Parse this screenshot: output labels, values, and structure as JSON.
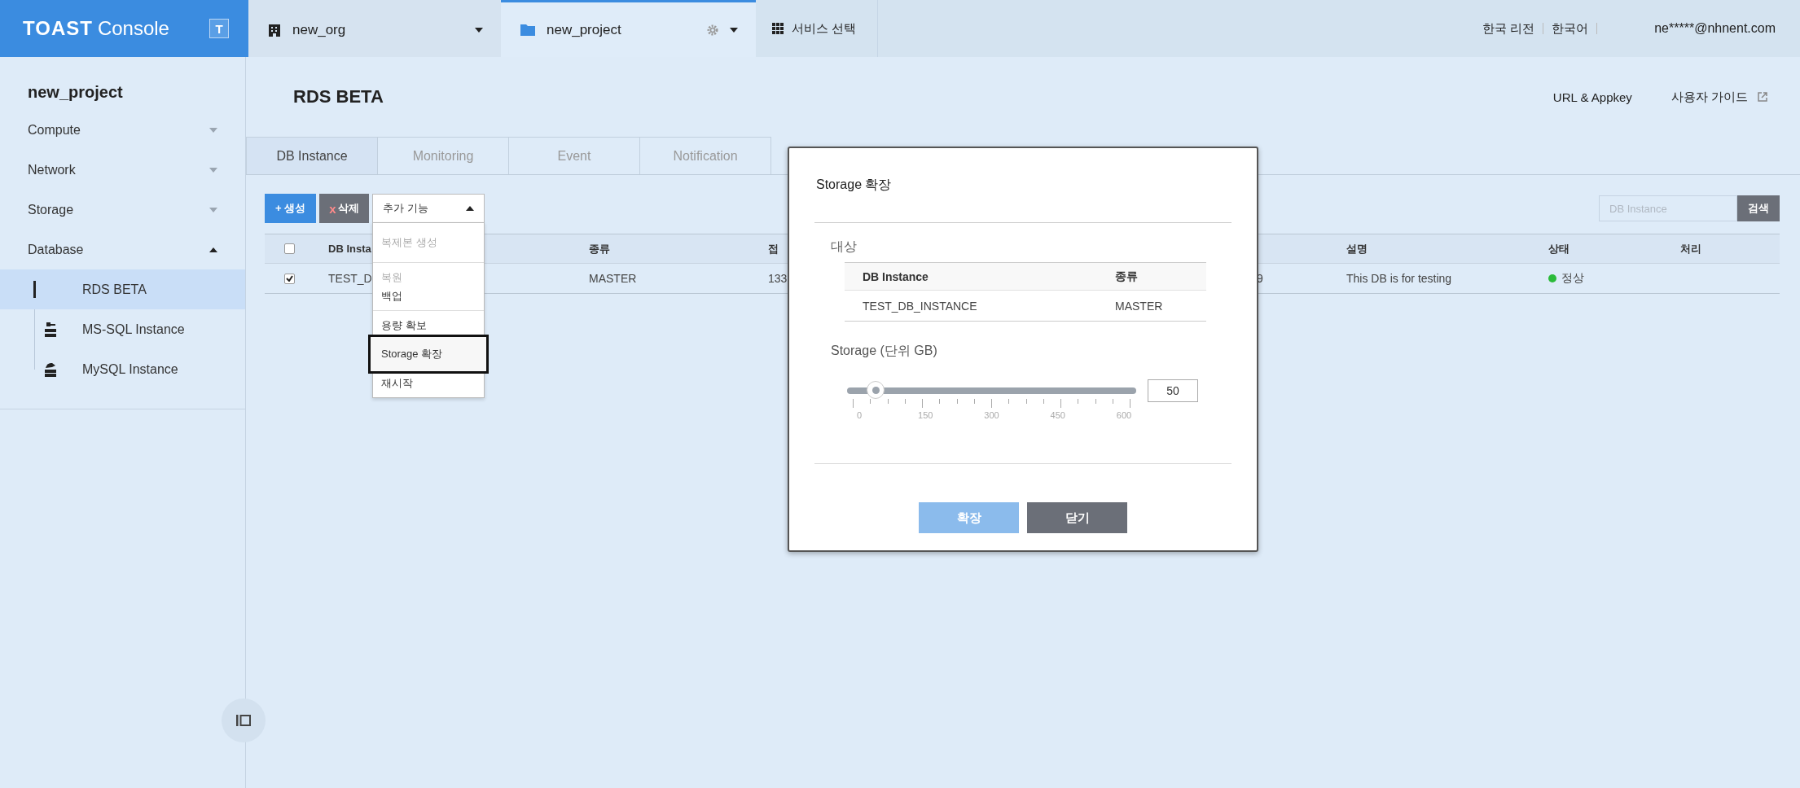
{
  "topbar": {
    "logo": {
      "brand": "TOAST",
      "product": "Console",
      "badge": "T"
    },
    "context_tabs": [
      {
        "kind": "org",
        "label": "new_org",
        "selected": false
      },
      {
        "kind": "project",
        "label": "new_project",
        "selected": true
      }
    ],
    "service_menu": "서비스 선택",
    "links": [
      "한국 리전",
      "한국어"
    ],
    "user": "ne*****@nhnent.com"
  },
  "sidebar": {
    "project": "new_project",
    "items": [
      {
        "label": "Compute",
        "expanded": false
      },
      {
        "label": "Network",
        "expanded": false
      },
      {
        "label": "Storage",
        "expanded": false
      },
      {
        "label": "Database",
        "expanded": true,
        "children": [
          {
            "label": "RDS BETA",
            "kind": "plain",
            "selected": true
          },
          {
            "label": "MS-SQL Instance",
            "kind": "mssql",
            "selected": false
          },
          {
            "label": "MySQL Instance",
            "kind": "mysql",
            "selected": false
          }
        ]
      }
    ]
  },
  "page": {
    "title": "RDS BETA",
    "links": [
      {
        "label": "URL & Appkey",
        "external": false
      },
      {
        "label": "사용자 가이드",
        "external": true
      }
    ]
  },
  "tabs": [
    {
      "label": "DB Instance",
      "selected": true
    },
    {
      "label": "Monitoring",
      "selected": false
    },
    {
      "label": "Event",
      "selected": false
    },
    {
      "label": "Notification",
      "selected": false
    }
  ],
  "toolbar": {
    "create": {
      "icon": "+",
      "label": "생성"
    },
    "delete": {
      "icon": "x",
      "label": "삭제"
    },
    "more": {
      "label": "추가 기능",
      "expanded": true
    }
  },
  "menu": {
    "groups": [
      {
        "items": [
          {
            "label": "복제본 생성",
            "disabled": true,
            "selected": false
          }
        ]
      },
      {
        "items": [
          {
            "label": "복원",
            "disabled": true,
            "selected": false
          },
          {
            "label": "백업",
            "disabled": false,
            "selected": false
          }
        ]
      },
      {
        "items": [
          {
            "label": "용량 확보",
            "disabled": false,
            "selected": false
          },
          {
            "label": "Storage 확장",
            "disabled": false,
            "selected": true
          },
          {
            "label": "재시작",
            "disabled": false,
            "selected": false
          }
        ]
      }
    ]
  },
  "search": {
    "placeholder": "DB Instance",
    "button": "검색"
  },
  "table": {
    "header_checked": false,
    "columns": [
      {
        "kind": "text",
        "label": "DB Insta"
      },
      {
        "kind": "text",
        "label": "종류"
      },
      {
        "kind": "text",
        "label": "접"
      },
      {
        "kind": "text"
      },
      {
        "kind": "text",
        "label": "설명"
      },
      {
        "kind": "status",
        "label": "상태"
      },
      {
        "kind": "text",
        "label": "처리"
      }
    ],
    "rows": [
      {
        "checked": true,
        "cells": [
          "TEST_D",
          "MASTER",
          "133",
          "9",
          "This DB is for testing",
          {
            "label": "정상",
            "color": "#2bbb3a"
          }
        ]
      }
    ]
  },
  "modal": {
    "title": "Storage 확장",
    "target_label": "대상",
    "target_table": {
      "columns": [
        "DB Instance",
        "종류"
      ],
      "rows": [
        [
          "TEST_DB_INSTANCE",
          "MASTER"
        ]
      ]
    },
    "storage_label": "Storage (단위 GB)",
    "slider": {
      "level": 0.0833,
      "ticks": [
        "0",
        "150",
        "300",
        "450",
        "600"
      ]
    },
    "value": "50",
    "buttons": [
      {
        "kind": "primary",
        "label": "확장",
        "disabled": true
      },
      {
        "kind": "secondary",
        "label": "닫기",
        "disabled": false
      }
    ]
  }
}
